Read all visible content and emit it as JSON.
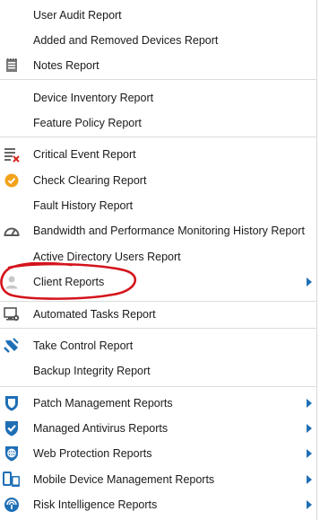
{
  "menu": {
    "items": [
      {
        "label": "User Audit Report"
      },
      {
        "label": "Added and Removed Devices Report"
      },
      {
        "label": "Notes Report",
        "icon": "notes-icon"
      },
      {
        "label": "Device Inventory Report"
      },
      {
        "label": "Feature Policy Report"
      },
      {
        "label": "Critical Event Report",
        "icon": "critical-event-icon"
      },
      {
        "label": "Check Clearing Report",
        "icon": "check-clearing-icon"
      },
      {
        "label": "Fault History Report"
      },
      {
        "label": "Bandwidth and Performance Monitoring History Report",
        "icon": "gauge-icon"
      },
      {
        "label": "Active Directory Users Report"
      },
      {
        "label": "Client Reports",
        "icon": "user-icon",
        "submenu": true
      },
      {
        "label": "Automated Tasks Report",
        "icon": "automated-tasks-icon"
      },
      {
        "label": "Take Control Report",
        "icon": "take-control-icon"
      },
      {
        "label": "Backup Integrity Report"
      },
      {
        "label": "Patch Management Reports",
        "icon": "shield-icon",
        "submenu": true
      },
      {
        "label": "Managed Antivirus Reports",
        "icon": "antivirus-shield-icon",
        "submenu": true
      },
      {
        "label": "Web Protection Reports",
        "icon": "globe-shield-icon",
        "submenu": true
      },
      {
        "label": "Mobile Device Management Reports",
        "icon": "mobile-device-icon",
        "submenu": true
      },
      {
        "label": "Risk Intelligence Reports",
        "icon": "risk-intelligence-icon",
        "submenu": true
      }
    ]
  },
  "colors": {
    "accent": "#1f6fb5",
    "annotation": "#d4141c",
    "check_orange": "#f2a21b"
  }
}
